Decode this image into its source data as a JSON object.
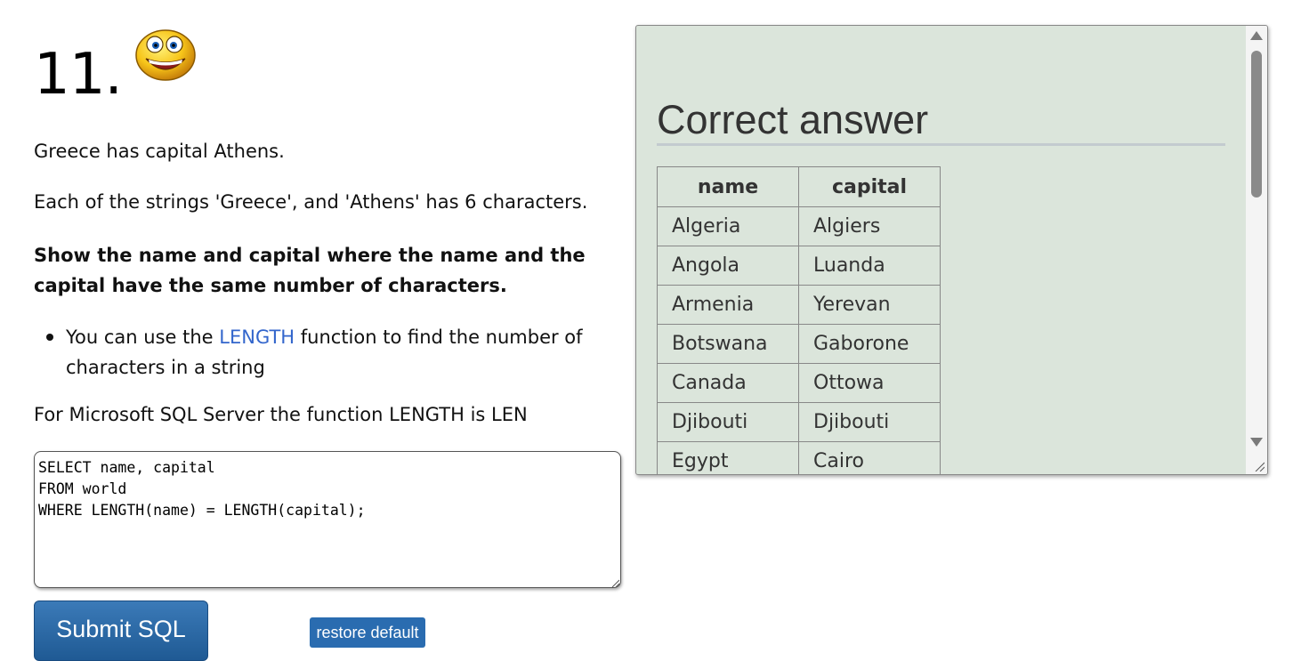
{
  "question": {
    "number": "11.",
    "emoji": "grinning-smiley-icon"
  },
  "text": {
    "p1": "Greece has capital Athens.",
    "p2": "Each of the strings 'Greece', and 'Athens' has 6 characters.",
    "p3": "Show the name and capital where the name and the capital have the same number of characters.",
    "bullet_before": "You can use the ",
    "bullet_link": "LENGTH",
    "bullet_after": " function to find the number of characters in a string",
    "p4": "For Microsoft SQL Server the function LENGTH is LEN"
  },
  "editor": {
    "value": "SELECT name, capital\nFROM world\nWHERE LENGTH(name) = LENGTH(capital);"
  },
  "buttons": {
    "submit": "Submit SQL",
    "restore": "restore default"
  },
  "answer": {
    "title": "Correct answer",
    "columns": [
      "name",
      "capital"
    ],
    "rows": [
      [
        "Algeria",
        "Algiers"
      ],
      [
        "Angola",
        "Luanda"
      ],
      [
        "Armenia",
        "Yerevan"
      ],
      [
        "Botswana",
        "Gaborone"
      ],
      [
        "Canada",
        "Ottowa"
      ],
      [
        "Djibouti",
        "Djibouti"
      ],
      [
        "Egypt",
        "Cairo"
      ]
    ]
  },
  "colors": {
    "link": "#3366cc",
    "answer_bg": "#dbe5db",
    "button": "#2a6cb0"
  }
}
